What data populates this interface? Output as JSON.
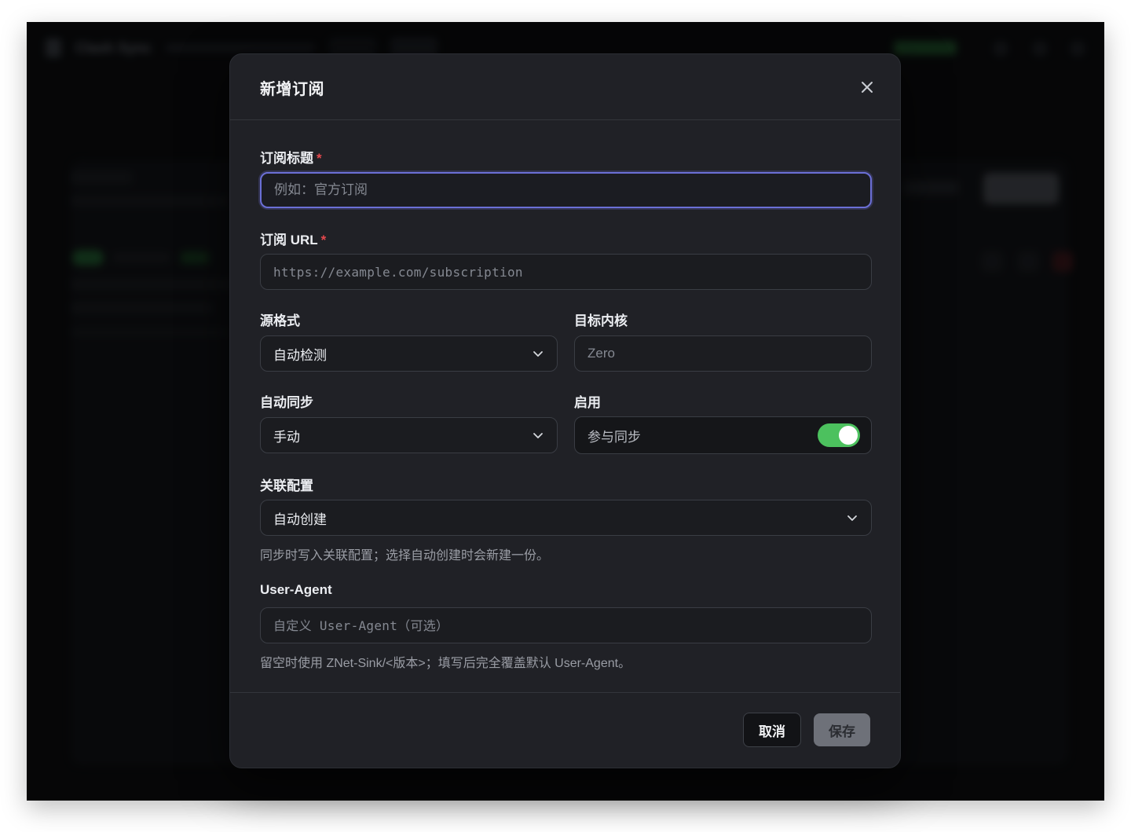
{
  "background": {
    "brand": "Clash Sync"
  },
  "modal": {
    "title": "新增订阅",
    "fields": {
      "title": {
        "label": "订阅标题",
        "required_mark": "*",
        "placeholder": "例如：官方订阅"
      },
      "url": {
        "label": "订阅 URL",
        "required_mark": "*",
        "placeholder": "https://example.com/subscription"
      },
      "source_format": {
        "label": "源格式",
        "value": "自动检测"
      },
      "target_core": {
        "label": "目标内核",
        "placeholder": "Zero"
      },
      "auto_sync": {
        "label": "自动同步",
        "value": "手动"
      },
      "enabled": {
        "label": "启用",
        "toggle_text": "参与同步",
        "checked": true
      },
      "linked_config": {
        "label": "关联配置",
        "value": "自动创建",
        "help": "同步时写入关联配置；选择自动创建时会新建一份。"
      },
      "user_agent": {
        "label": "User-Agent",
        "placeholder": "自定义 User-Agent（可选）",
        "help": "留空时使用 ZNet-Sink/<版本>；填写后完全覆盖默认 User-Agent。"
      }
    },
    "buttons": {
      "cancel": "取消",
      "save": "保存"
    }
  },
  "colors": {
    "accent_focus": "#6b6fd6",
    "toggle_on": "#4cc15e",
    "required": "#e5484d"
  }
}
